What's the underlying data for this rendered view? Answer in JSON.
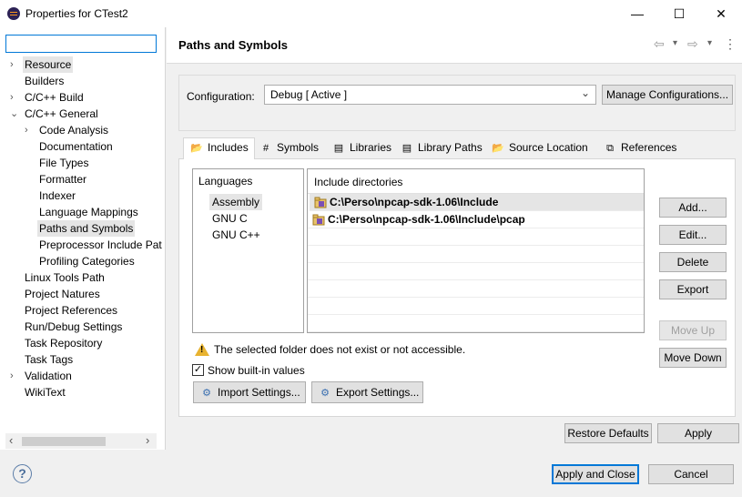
{
  "window": {
    "title": "Properties for CTest2",
    "minimize_glyph": "—",
    "maximize_glyph": "☐",
    "close_glyph": "✕"
  },
  "sidebar": {
    "filter_value": "",
    "items": [
      {
        "label": "Resource",
        "level": 0,
        "twisty": "›",
        "selected": true
      },
      {
        "label": "Builders",
        "level": 0,
        "twisty": ""
      },
      {
        "label": "C/C++ Build",
        "level": 0,
        "twisty": "›"
      },
      {
        "label": "C/C++ General",
        "level": 0,
        "twisty": "⌄"
      },
      {
        "label": "Code Analysis",
        "level": 1,
        "twisty": "›"
      },
      {
        "label": "Documentation",
        "level": 1,
        "twisty": ""
      },
      {
        "label": "File Types",
        "level": 1,
        "twisty": ""
      },
      {
        "label": "Formatter",
        "level": 1,
        "twisty": ""
      },
      {
        "label": "Indexer",
        "level": 1,
        "twisty": ""
      },
      {
        "label": "Language Mappings",
        "level": 1,
        "twisty": ""
      },
      {
        "label": "Paths and Symbols",
        "level": 1,
        "twisty": "",
        "selected": true
      },
      {
        "label": "Preprocessor Include Pat",
        "level": 1,
        "twisty": ""
      },
      {
        "label": "Profiling Categories",
        "level": 1,
        "twisty": ""
      },
      {
        "label": "Linux Tools Path",
        "level": 0,
        "twisty": ""
      },
      {
        "label": "Project Natures",
        "level": 0,
        "twisty": ""
      },
      {
        "label": "Project References",
        "level": 0,
        "twisty": ""
      },
      {
        "label": "Run/Debug Settings",
        "level": 0,
        "twisty": ""
      },
      {
        "label": "Task Repository",
        "level": 0,
        "twisty": ""
      },
      {
        "label": "Task Tags",
        "level": 0,
        "twisty": ""
      },
      {
        "label": "Validation",
        "level": 0,
        "twisty": "›"
      },
      {
        "label": "WikiText",
        "level": 0,
        "twisty": ""
      }
    ],
    "scroll_left_glyph": "‹",
    "scroll_right_glyph": "›"
  },
  "page": {
    "title": "Paths and Symbols",
    "nav_back_glyph": "⇦",
    "nav_forward_glyph": "⇨",
    "menu_glyph": "⋮",
    "dropdown_glyph": "▾"
  },
  "configuration": {
    "label": "Configuration:",
    "value": "Debug  [ Active ]",
    "manage_label": "Manage Configurations..."
  },
  "tabs": [
    {
      "label": "Includes",
      "icon": "📂",
      "active": true
    },
    {
      "label": "Symbols",
      "icon": "#"
    },
    {
      "label": "Libraries",
      "icon": "▤"
    },
    {
      "label": "Library Paths",
      "icon": "▤"
    },
    {
      "label": "Source Location",
      "icon": "📂"
    },
    {
      "label": "References",
      "icon": "⧉"
    }
  ],
  "languages": {
    "header": "Languages",
    "items": [
      "Assembly",
      "GNU C",
      "GNU C++"
    ],
    "selected_index": 0
  },
  "include_dirs": {
    "header": "Include directories",
    "rows": [
      "C:\\Perso\\npcap-sdk-1.06\\Include",
      "C:\\Perso\\npcap-sdk-1.06\\Include\\pcap"
    ]
  },
  "side_buttons": {
    "add": "Add...",
    "edit": "Edit...",
    "delete": "Delete",
    "export": "Export",
    "move_up": "Move Up",
    "move_down": "Move Down"
  },
  "warning_text": "The selected folder does not exist or not accessible.",
  "show_builtin": {
    "label": "Show built-in values",
    "checked": true,
    "check_glyph": "✓"
  },
  "import_settings": "Import Settings...",
  "export_settings": "Export Settings...",
  "restore_defaults": "Restore Defaults",
  "apply": "Apply",
  "apply_and_close": "Apply and Close",
  "cancel": "Cancel",
  "help_glyph": "?",
  "colors": {
    "accent": "#0078d7",
    "selection": "#e5e5e5",
    "warning": "#e8b330"
  }
}
